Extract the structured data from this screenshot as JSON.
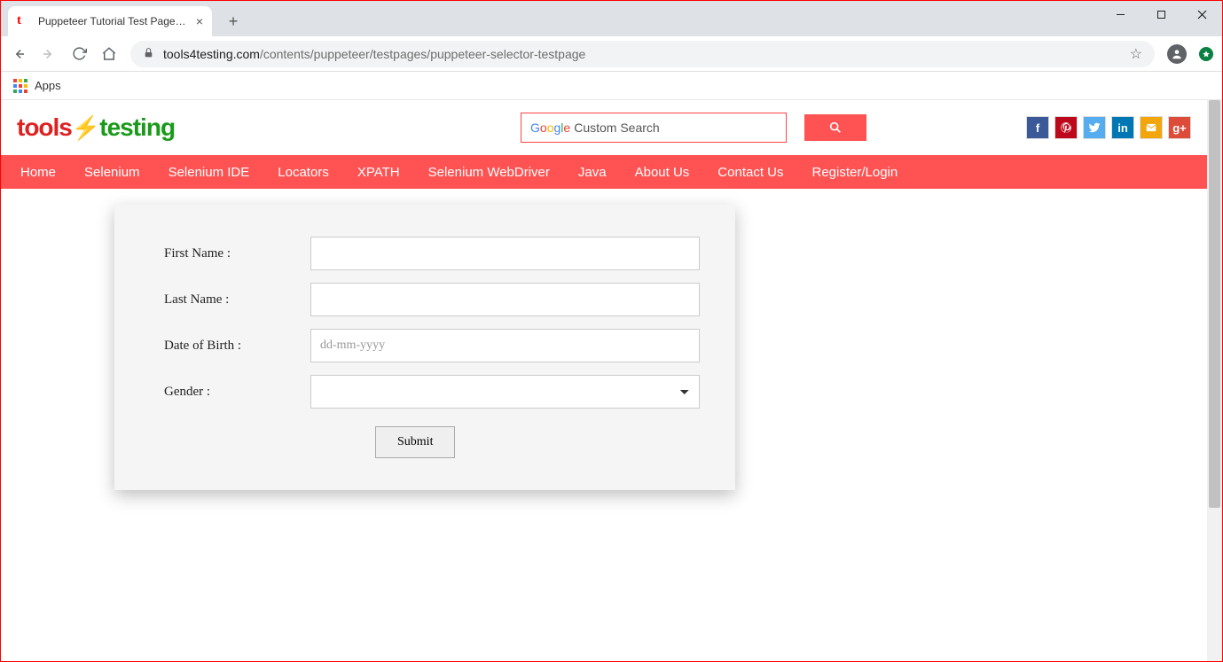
{
  "browser": {
    "tab_title": "Puppeteer Tutorial Test Page - to",
    "url_host": "tools4testing.com",
    "url_path": "/contents/puppeteer/testpages/puppeteer-selector-testpage",
    "apps_label": "Apps"
  },
  "site": {
    "logo_part1": "tools",
    "logo_part2": "testing",
    "search_placeholder": "Custom Search"
  },
  "nav": {
    "items": [
      "Home",
      "Selenium",
      "Selenium IDE",
      "Locators",
      "XPATH",
      "Selenium WebDriver",
      "Java",
      "About Us",
      "Contact Us",
      "Register/Login"
    ]
  },
  "social": {
    "facebook": "f",
    "pinterest": "",
    "twitter": "",
    "linkedin": "in",
    "mail": "",
    "gplus": "g+"
  },
  "form": {
    "first_name_label": "First Name :",
    "last_name_label": "Last Name :",
    "dob_label": "Date of Birth :",
    "dob_placeholder": "dd-mm-yyyy",
    "gender_label": "Gender :",
    "submit_label": "Submit"
  }
}
